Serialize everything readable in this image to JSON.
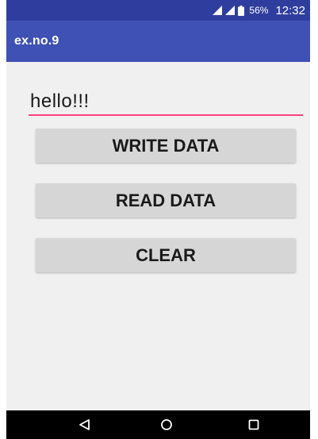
{
  "status_bar": {
    "battery_text": "56%",
    "time": "12:32",
    "icons": [
      "signal-icon",
      "signal-icon",
      "battery-icon"
    ]
  },
  "app_bar": {
    "title": "ex.no.9",
    "color": "#3f51b5"
  },
  "text_field": {
    "value": "hello!!!",
    "underline_color": "#ff4081"
  },
  "buttons": {
    "write_data": "WRITE DATA",
    "read_data": "READ DATA",
    "clear": "CLEAR"
  },
  "nav_bar": {
    "icons": [
      "back-icon",
      "home-icon",
      "recent-apps-icon"
    ]
  }
}
